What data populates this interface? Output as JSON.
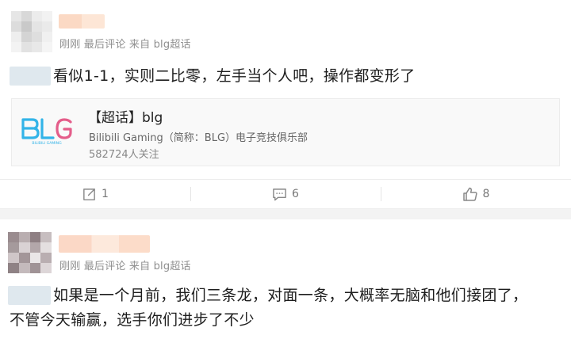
{
  "posts": [
    {
      "meta": "刚刚 最后评论 来自 blg超话",
      "content": "看似1-1，实则二比零，左手当个人吧，操作都变形了",
      "card": {
        "title": "【超话】blg",
        "subtitle": "Bilibili Gaming（简称：BLG）电子竞技俱乐部",
        "followers": "582724人关注",
        "logo_text": "BLG",
        "logo_caption": "BILIBILI GAMING"
      },
      "actions": {
        "share": "1",
        "comment": "6",
        "like": "8"
      }
    },
    {
      "meta": "刚刚 最后评论 来自 blg超话",
      "content_line1": "如果是一个月前，我们三条龙，对面一条，大概率无脑和他们接团了，",
      "content_line2": "不管今天输赢，选手你们进步了不少"
    }
  ],
  "colors": {
    "logo_blue": "#33b4e8",
    "logo_pink": "#e45d8a",
    "meta_gray": "#8f8f8f",
    "separator": "#f3f3f3"
  },
  "icons": [
    "share-icon",
    "comment-icon",
    "like-icon"
  ]
}
